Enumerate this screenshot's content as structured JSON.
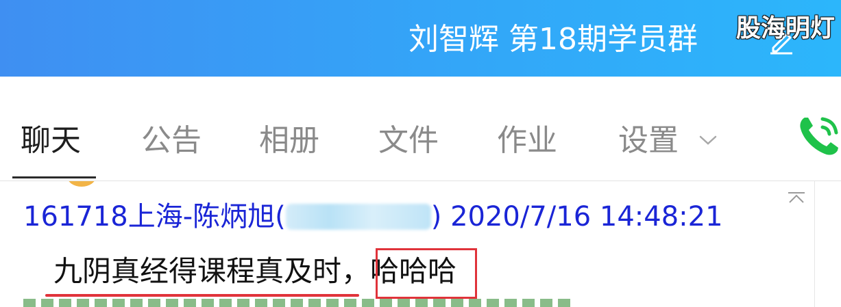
{
  "header": {
    "group_title": "刘智辉 第18期学员群",
    "watermark": "股海明灯",
    "edit_icon": "edit-icon"
  },
  "tabs": [
    {
      "label": "聊天",
      "active": true
    },
    {
      "label": "公告",
      "active": false
    },
    {
      "label": "相册",
      "active": false
    },
    {
      "label": "文件",
      "active": false
    },
    {
      "label": "作业",
      "active": false
    },
    {
      "label": "设置",
      "active": false
    }
  ],
  "call_icon": "phone-icon",
  "message": {
    "sender_name": "161718上海-陈炳旭(",
    "sender_close": ")",
    "timestamp": "2020/7/16 14:48:21",
    "text_part1": "九阴真经得课程真及时，",
    "text_part2": "哈哈哈"
  },
  "colors": {
    "header_gradient_start": "#3f8ff2",
    "header_gradient_end": "#2cb6fb",
    "sender_color": "#1a25d6",
    "highlight_red": "#e0333a",
    "call_green": "#1fc24a"
  }
}
